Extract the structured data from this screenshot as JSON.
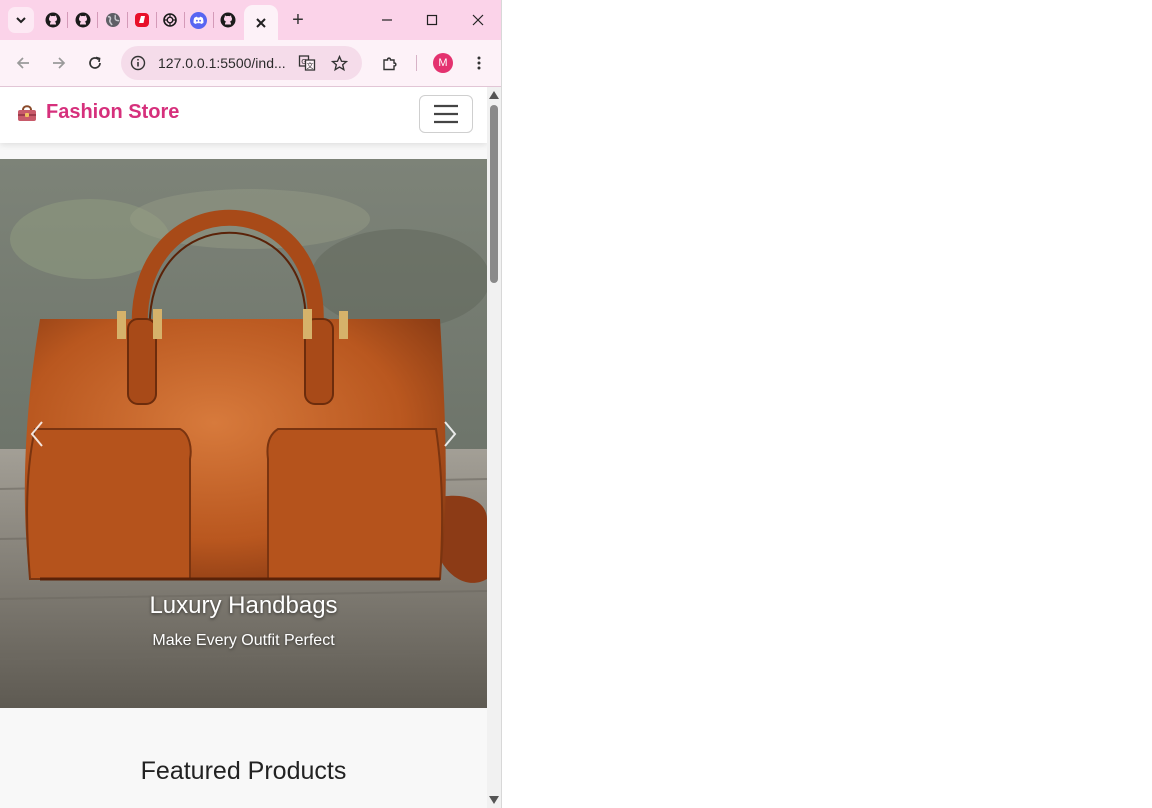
{
  "browser": {
    "tabs": [
      {
        "name": "github-tab-1",
        "icon": "github-icon"
      },
      {
        "name": "github-tab-2",
        "icon": "github-icon"
      },
      {
        "name": "globe-tab",
        "icon": "globe-icon"
      },
      {
        "name": "red-app-tab",
        "icon": "app-icon"
      },
      {
        "name": "chatgpt-tab",
        "icon": "openai-icon"
      },
      {
        "name": "discord-tab",
        "icon": "discord-icon"
      },
      {
        "name": "github-tab-3",
        "icon": "github-icon"
      }
    ],
    "active_tab_icon": "close-icon",
    "new_tab_label": "+",
    "address": "127.0.0.1:5500/ind...",
    "profile_initial": "M",
    "accent": "#fbd3e9",
    "avatar_color": "#e4326f"
  },
  "site": {
    "brand": "Fashion Store",
    "brand_icon": "handbag-icon",
    "brand_color": "#d6307c",
    "menu_icon": "hamburger-icon"
  },
  "carousel": {
    "title": "Luxury Handbags",
    "subtitle": "Make Every Outfit Perfect"
  },
  "featured": {
    "heading": "Featured Products"
  }
}
